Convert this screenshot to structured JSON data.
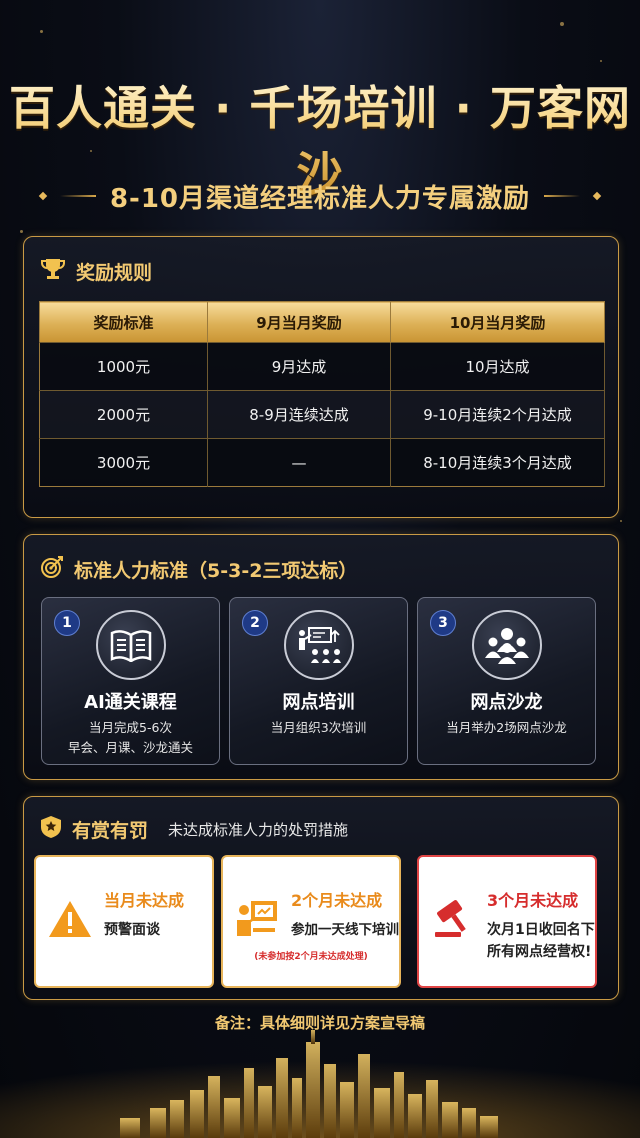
{
  "header": {
    "title": "百人通关 · 千场培训 · 万客网沙",
    "subtitle": "8-10月渠道经理标准人力专属激励"
  },
  "rewards": {
    "title": "奖励规则",
    "icon": "trophy-icon",
    "columns": [
      "奖励标准",
      "9月当月奖励",
      "10月当月奖励"
    ],
    "rows": [
      [
        "1000元",
        "9月达成",
        "10月达成"
      ],
      [
        "2000元",
        "8-9月连续达成",
        "9-10月连续2个月达成"
      ],
      [
        "3000元",
        "—",
        "8-10月连续3个月达成"
      ]
    ]
  },
  "standards": {
    "title": "标准人力标准（5-3-2三项达标）",
    "icon": "target-icon",
    "cards": [
      {
        "num": "1",
        "icon": "book-icon",
        "title": "AI通关课程",
        "desc1": "当月完成5-6次",
        "desc2": "早会、月课、沙龙通关"
      },
      {
        "num": "2",
        "icon": "training-icon",
        "title": "网点培训",
        "desc1": "当月组织3次培训",
        "desc2": ""
      },
      {
        "num": "3",
        "icon": "group-icon",
        "title": "网点沙龙",
        "desc1": "当月举办2场网点沙龙",
        "desc2": ""
      }
    ]
  },
  "penalties": {
    "title": "有赏有罚",
    "note": "未达成标准人力的处罚措施",
    "icon": "shield-icon",
    "cards": [
      {
        "icon": "warning-icon",
        "title": "当月未达成",
        "desc1": "预警面谈",
        "desc2": "",
        "small": ""
      },
      {
        "icon": "training-board-icon",
        "title": "2个月未达成",
        "desc1": "参加一天线下培训",
        "desc2": "",
        "small": "(未参加按2个月未达成处理)"
      },
      {
        "icon": "gavel-icon",
        "title": "3个月未达成",
        "desc1": "次月1日收回名下",
        "desc2": "所有网点经营权!",
        "small": ""
      }
    ]
  },
  "footnote": "备注：具体细则详见方案宣导稿",
  "colors": {
    "gold": "#f2c972",
    "orange": "#e98b1c",
    "red": "#d62d2d",
    "badge_blue": "#1f3a86"
  }
}
